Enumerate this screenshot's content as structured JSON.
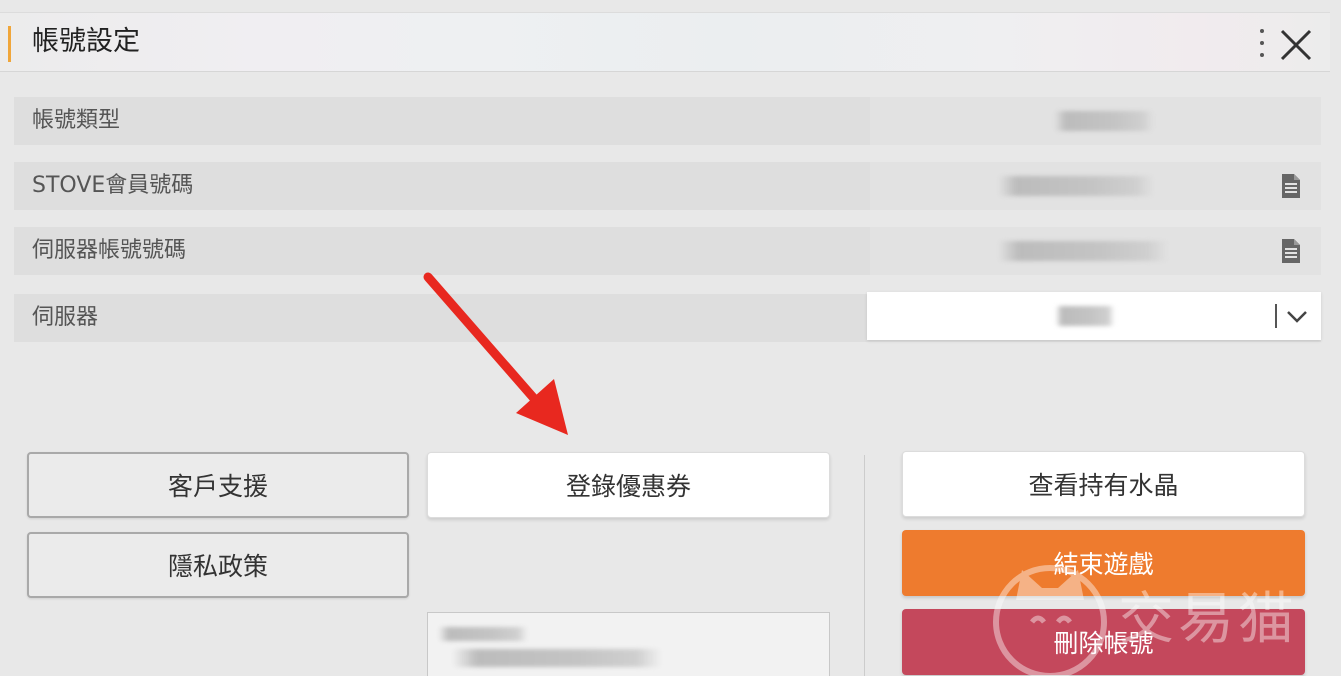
{
  "header": {
    "title": "帳號設定",
    "menu_icon": "more-vertical-icon",
    "close_icon": "close-icon"
  },
  "rows": [
    {
      "label": "帳號類型"
    },
    {
      "label": "STOVE會員號碼"
    },
    {
      "label": "伺服器帳號號碼"
    },
    {
      "label": "伺服器"
    }
  ],
  "buttons": {
    "customer_support": "客戶支援",
    "privacy_policy": "隱私政策",
    "register_coupon": "登錄優惠券",
    "view_crystals": "查看持有水晶",
    "exit_game": "結束遊戲",
    "delete_account": "刪除帳號"
  },
  "watermark": {
    "text": "交易猫"
  },
  "colors": {
    "accent": "#f0a63a",
    "exit_button": "#ee7b2e",
    "delete_button": "#c4485c",
    "annotation_arrow": "#e8281f"
  }
}
